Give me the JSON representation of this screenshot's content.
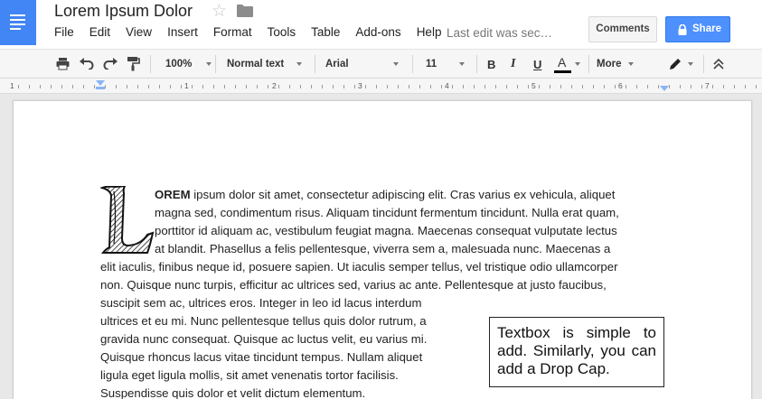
{
  "doc": {
    "title": "Lorem Ipsum Dolor",
    "last_edit": "Last edit was sec…"
  },
  "menu": [
    "File",
    "Edit",
    "View",
    "Insert",
    "Format",
    "Tools",
    "Table",
    "Add-ons",
    "Help"
  ],
  "header_buttons": {
    "comments": "Comments",
    "share": "Share"
  },
  "toolbar": {
    "zoom": "100%",
    "style": "Normal text",
    "font": "Arial",
    "size": "11",
    "bold": "B",
    "italic": "I",
    "underline": "U",
    "text_color": "A",
    "more": "More"
  },
  "ruler": {
    "labels": [
      "1",
      "1",
      "2",
      "3",
      "4",
      "5",
      "6",
      "7"
    ]
  },
  "body": {
    "dropcap_bold": "OREM",
    "lines": [
      " ipsum dolor sit amet, consectetur adipiscing elit. Cras varius ex vehicula, aliquet",
      "magna sed, condimentum risus. Aliquam tincidunt fermentum tincidunt. Nulla erat quam,",
      "porttitor id aliquam ac, vestibulum feugiat magna. Maecenas consequat vulputate lectus",
      "at blandit. Phasellus a felis pellentesque, viverra sem a, malesuada nunc. Maecenas a",
      "elit iaculis, finibus neque id, posuere sapien. Ut iaculis semper tellus, vel tristique odio ullamcorper",
      "non. Quisque nunc turpis, efficitur ac ultrices sed, varius ac ante. Pellentesque at justo faucibus,",
      "suscipit sem ac, ultrices eros. Integer in leo id lacus interdum",
      "ultrices et eu mi. Nunc pellentesque tellus quis dolor rutrum, a",
      "gravida nunc consequat. Quisque ac luctus velit, eu varius mi.",
      "Quisque rhoncus lacus vitae tincidunt tempus. Nullam aliquet",
      "ligula eget ligula mollis, sit amet venenatis tortor facilisis.",
      "Suspendisse quis dolor et velit dictum elementum."
    ]
  },
  "textbox": {
    "text": "Textbox is simple to add. Similarly, you can add a Drop Cap."
  },
  "colors": {
    "accent": "#4285f4",
    "share": "#4d90fe",
    "text_color_bar": "#000000"
  }
}
